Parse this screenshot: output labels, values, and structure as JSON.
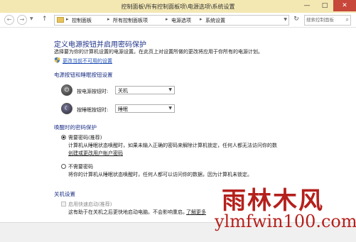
{
  "window": {
    "title": "控制面板\\所有控制面板项\\电源选项\\系统设置",
    "minimize": "—",
    "maximize": "□",
    "close": "✕"
  },
  "nav": {
    "back": "←",
    "forward": "→",
    "up": "↑",
    "breadcrumb": [
      "控制面板",
      "所有控制面板项",
      "电源选项",
      "系统设置"
    ],
    "refresh": "↻",
    "search_placeholder": "搜索控制面板"
  },
  "page": {
    "heading": "定义电源按钮并启用密码保护",
    "description": "选择要为你的计算机设置的电源设置。在此页上对设置所做的更改将应用于你所有的电源计划。",
    "change_unavailable_link": "更改当前不可用的设置"
  },
  "power_buttons": {
    "section_title": "电源按钮和睡眠按钮设置",
    "power_button_label": "按电源按钮时:",
    "power_button_value": "关机",
    "sleep_button_label": "按睡眠按钮时:",
    "sleep_button_value": "睡眠"
  },
  "wake_password": {
    "section_title": "唤醒时的密码保护",
    "require": {
      "label": "需要密码(推荐)",
      "selected": true,
      "description": "计算机从睡眠状态唤醒时，如果未输入正确的密码来解除计算机锁定，任何人都无法访问你的数",
      "link": "创建或更改用户帐户密码"
    },
    "no_require": {
      "label": "不需要密码",
      "selected": false,
      "description": "将你的计算机从睡眠状态唤醒时，任何人都可以访问你的数据，因为计算机未锁定。"
    }
  },
  "shutdown": {
    "section_title": "关机设置",
    "fast_startup_label": "启用快速启动(推荐)",
    "fast_startup_desc": "这有助于在关机之后更快地启动电脑。不会影响重启。",
    "learn_more": "了解更多"
  },
  "watermark": {
    "brand": "雨林木风",
    "url": "ylmfwin100.com"
  },
  "colors": {
    "titlebar": "#f3e7b2",
    "heading": "#1e3287",
    "link": "#1f4fb5",
    "watermark": "#b5201c"
  }
}
